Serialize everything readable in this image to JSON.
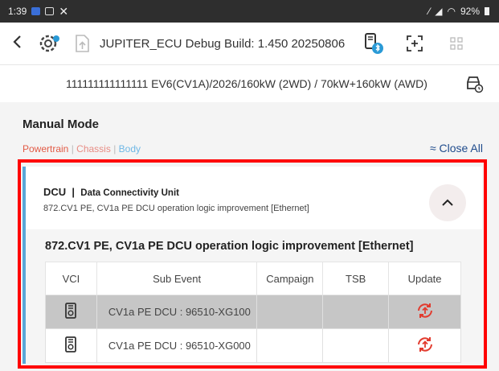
{
  "status_bar": {
    "time": "1:39",
    "right_text": "92%"
  },
  "toolbar": {
    "back_icon": "chevron-left-icon",
    "title": "JUPITER_ECU Debug Build: 1.450 20250806"
  },
  "vehicle": {
    "info": "111111111111111  EV6(CV1A)/2026/160kW (2WD) / 70kW+160kW (AWD)"
  },
  "manual_mode": {
    "title": "Manual Mode",
    "tabs": {
      "powertrain": "Powertrain",
      "chassis": "Chassis",
      "body": "Body",
      "separator": "|"
    },
    "close_all": "≈ Close All"
  },
  "dcu_panel": {
    "code": "DCU",
    "separator": "|",
    "name": "Data Connectivity Unit",
    "description": "872.CV1 PE, CV1a PE DCU operation logic improvement [Ethernet]",
    "event_title": "872.CV1 PE, CV1a PE DCU operation logic improvement [Ethernet]",
    "table": {
      "headers": [
        "VCI",
        "Sub Event",
        "Campaign",
        "TSB",
        "Update"
      ],
      "rows": [
        {
          "sub_event": "CV1a PE DCU : 96510-XG100",
          "campaign": "",
          "tsb": "",
          "selected": true
        },
        {
          "sub_event": "CV1a PE DCU : 96510-XG000",
          "campaign": "",
          "tsb": "",
          "selected": false
        }
      ]
    }
  },
  "colors": {
    "powertrain": "#e25a45",
    "chassis": "#e88c84",
    "body": "#6fb8e6",
    "close_all": "#1f4b8c",
    "update_icon": "#e23b2e",
    "panel_accent": "#5aa7d8",
    "highlight_box": "#ff0000",
    "selected_row": "#c6c6c6"
  }
}
